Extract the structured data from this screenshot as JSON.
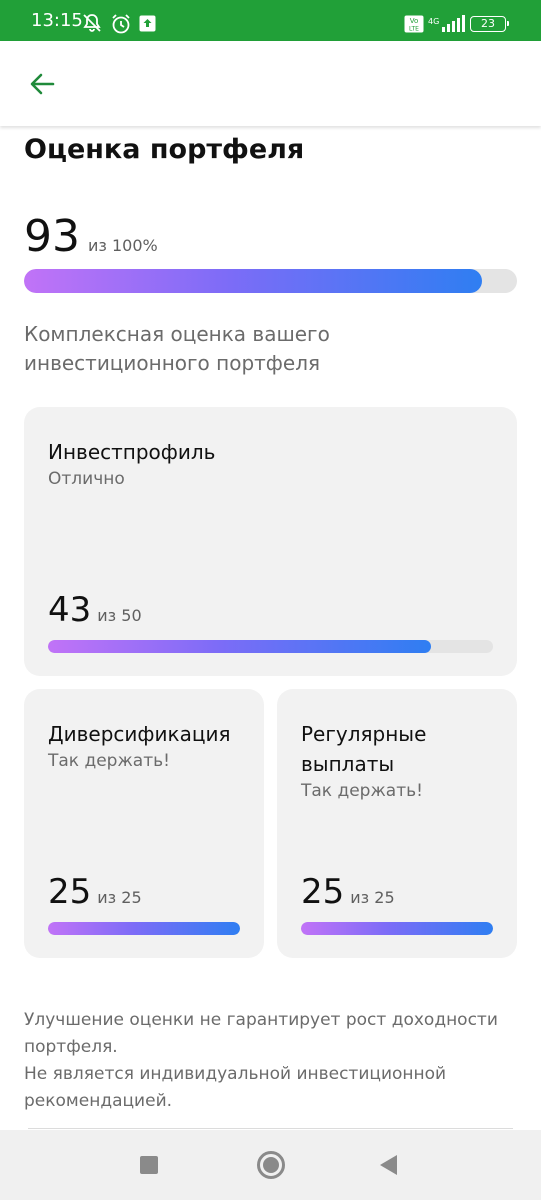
{
  "status_bar": {
    "time": "13:15",
    "battery": "23",
    "network": "4G",
    "volte": "Vo LTE",
    "background_color": "#21a038"
  },
  "app_bar": {
    "back_icon": "arrow-left-icon",
    "accent_color": "#21a038"
  },
  "page": {
    "title": "Оценка портфеля",
    "score": "93",
    "score_of": "из 100%",
    "score_fraction": 0.93,
    "subtitle": "Комплексная оценка вашего инвестиционного портфеля"
  },
  "cards": [
    {
      "title": "Инвестпрофиль",
      "status": "Отлично",
      "score": "43",
      "of": "из 50",
      "fraction": 0.86
    },
    {
      "title": "Диверсификация",
      "status": "Так держать!",
      "score": "25",
      "of": "из 25",
      "fraction": 1.0
    },
    {
      "title": "Регулярные выплаты",
      "status": "Так держать!",
      "score": "25",
      "of": "из 25",
      "fraction": 1.0
    }
  ],
  "disclaimer": {
    "line1": "Улучшение оценки не гарантирует рост доходности портфеля.",
    "line2": "Не является индивидуальной инвестиционной рекомендацией."
  },
  "gradient_colors": [
    "#c173f7",
    "#7c6cf7",
    "#2f7ef2"
  ]
}
